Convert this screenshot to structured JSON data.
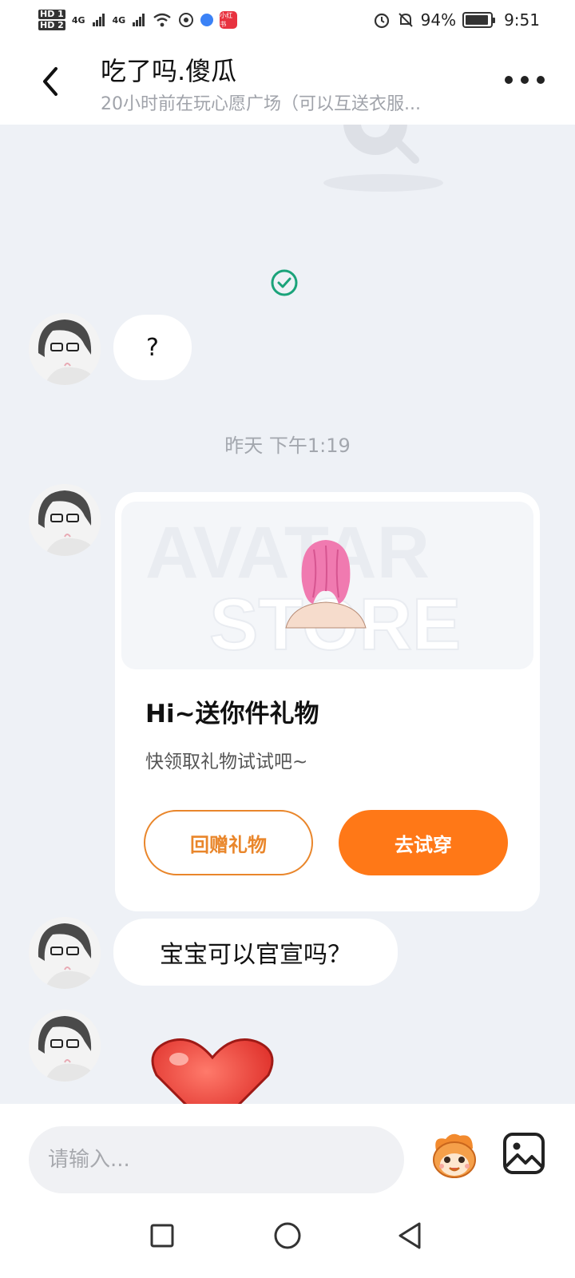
{
  "status_bar": {
    "network_hd_1": "HD 1",
    "network_hd_2": "HD 2",
    "signal_1": "4G",
    "signal_2": "4G",
    "app_badge": "小红书",
    "battery_percent": "94%",
    "battery_level": 0.94,
    "time": "9:51"
  },
  "header": {
    "title": "吃了吗.傻瓜",
    "subtitle": "20小时前在玩心愿广场（可以互送衣服..."
  },
  "chat": {
    "messages": [
      {
        "type": "text",
        "text": "?"
      },
      {
        "type": "timestamp",
        "text": "昨天 下午1:19"
      },
      {
        "type": "gift_card",
        "title": "Hi~送你件礼物",
        "subtitle": "快领取礼物试试吧~",
        "return_gift_label": "回赠礼物",
        "try_on_label": "去试穿"
      },
      {
        "type": "text",
        "text": "宝宝可以官宣吗？"
      },
      {
        "type": "sticker",
        "sticker": "heart-sticker"
      }
    ]
  },
  "input": {
    "placeholder": "请输入..."
  },
  "colors": {
    "accent_orange": "#ff7817",
    "outline_orange": "#e9862b",
    "check_green": "#1aa37a",
    "background": "#eef1f6"
  },
  "icons": {
    "back": "chevron-left-icon",
    "more": "more-dots-icon",
    "check": "check-circle-icon",
    "emoji": "emoji-mascot-icon",
    "image": "image-icon",
    "nav_recent": "square-icon",
    "nav_home": "circle-icon",
    "nav_back": "triangle-back-icon"
  }
}
